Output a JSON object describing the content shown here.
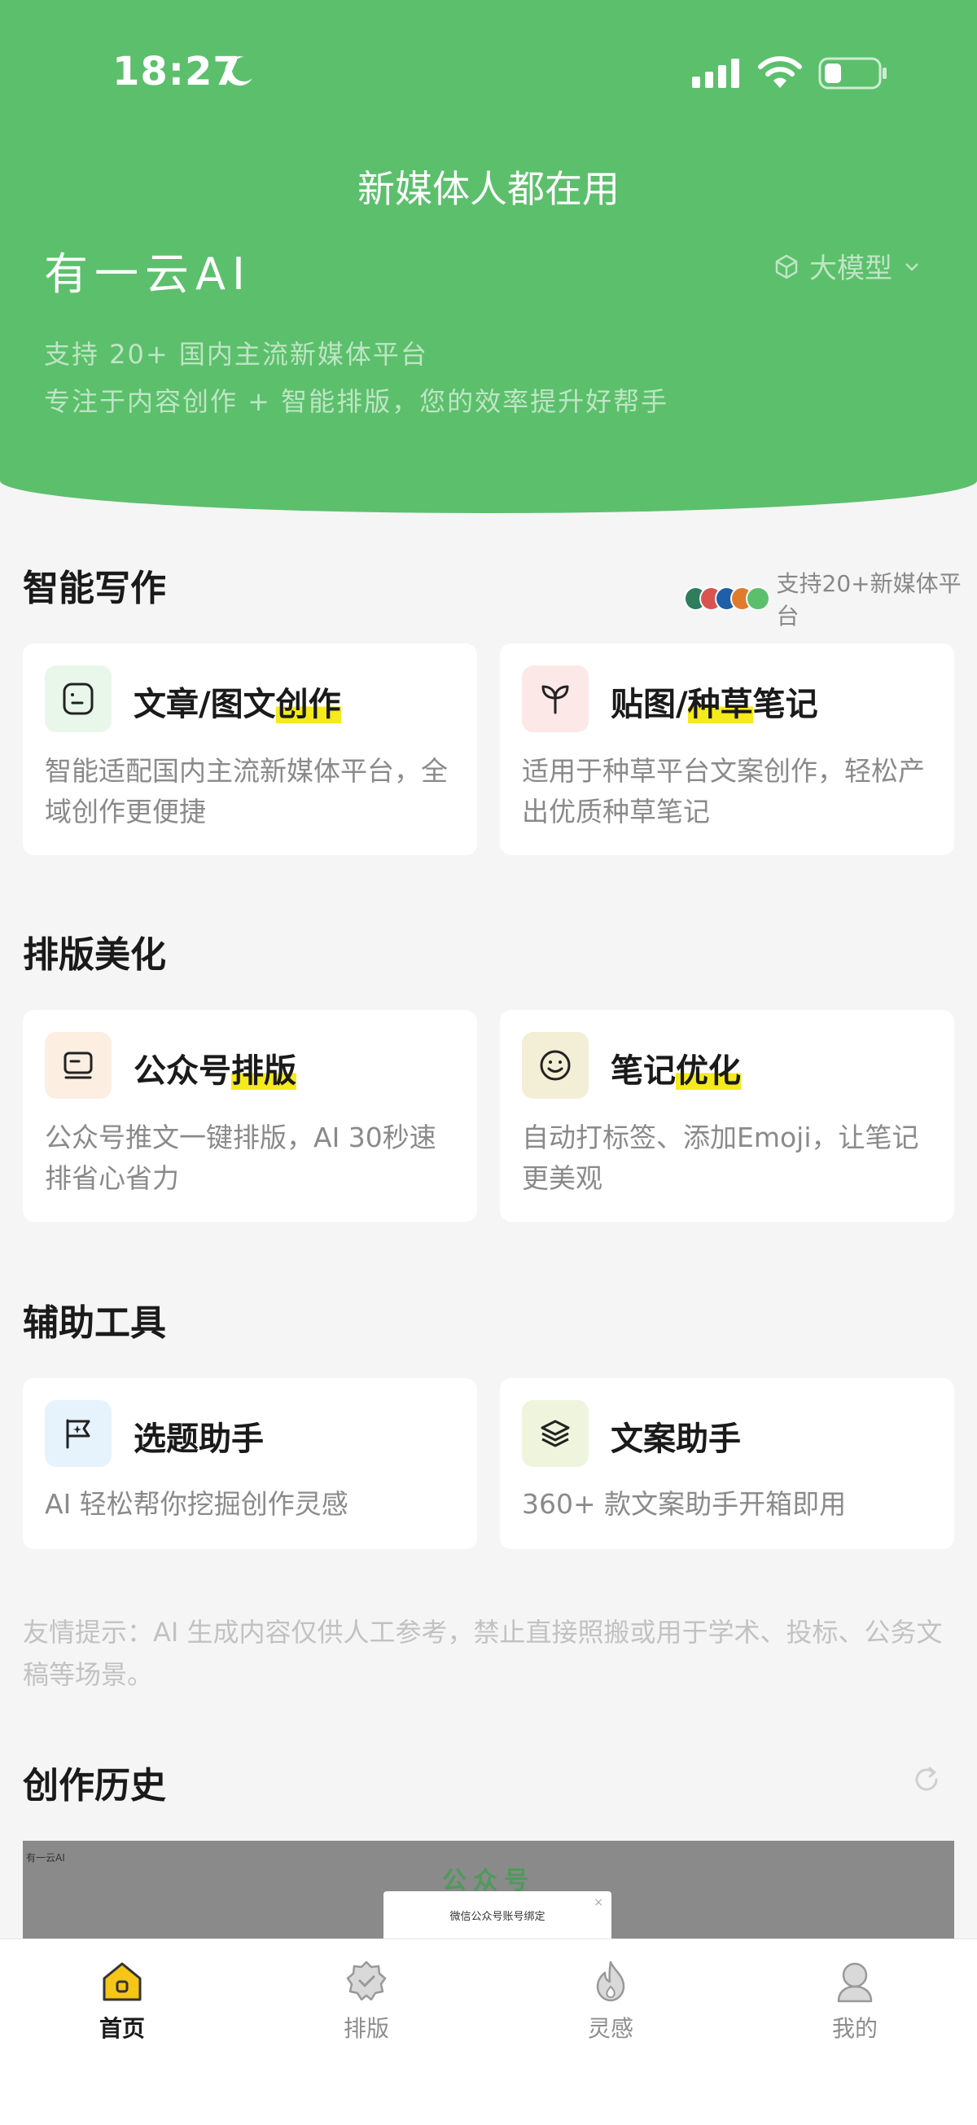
{
  "status_bar": {
    "time": "18:27"
  },
  "header": {
    "slogan": "新媒体人都在用",
    "brand": "有一云AI",
    "model_selector": "大模型",
    "desc_line1": "支持 20+ 国内主流新媒体平台",
    "desc_line2": "专注于内容创作 + 智能排版，您的效率提升好帮手"
  },
  "sections": {
    "writing": {
      "title": "智能写作",
      "platforms_label": "支持20+新媒体平台",
      "cards": [
        {
          "title_pre": "文章/图文",
          "title_hl": "创作",
          "title_post": "",
          "desc": "智能适配国内主流新媒体平台，全域创作更便捷",
          "icon": "doc-face-icon",
          "icon_bg": "#e8f7ea"
        },
        {
          "title_pre": "贴图/",
          "title_hl": "种草",
          "title_post": "笔记",
          "desc": "适用于种草平台文案创作，轻松产出优质种草笔记",
          "icon": "sprout-icon",
          "icon_bg": "#fde8e8"
        }
      ]
    },
    "layout": {
      "title": "排版美化",
      "cards": [
        {
          "title_pre": "公众号",
          "title_hl": "排版",
          "title_post": "",
          "desc": "公众号推文一键排版，AI 30秒速排省心省力",
          "icon": "monitor-icon",
          "icon_bg": "#fdeee2"
        },
        {
          "title_pre": "笔记",
          "title_hl": "优化",
          "title_post": "",
          "desc": "自动打标签、添加Emoji，让笔记更美观",
          "icon": "smiley-icon",
          "icon_bg": "#f3eed6"
        }
      ]
    },
    "tools": {
      "title": "辅助工具",
      "cards": [
        {
          "title": "选题助手",
          "desc": "AI 轻松帮你挖掘创作灵感",
          "icon": "flag-sparkle-icon",
          "icon_bg": "#e6f3fd"
        },
        {
          "title": "文案助手",
          "desc": "360+ 款文案助手开箱即用",
          "icon": "layers-icon",
          "icon_bg": "#eef5dc"
        }
      ]
    },
    "notice": "友情提示：AI 生成内容仅供人工参考，禁止直接照搬或用于学术、投标、公务文稿等场景。",
    "history": {
      "title": "创作历史",
      "preview_title": "公众号",
      "preview_corner": "有一云AI",
      "preview_dialog": "微信公众号账号绑定"
    }
  },
  "colors": {
    "brand_green": "#5cbf6c",
    "highlight_yellow": "#f5ea1c",
    "platform_dots": [
      "#2e7d5b",
      "#d9534f",
      "#1e5fa8",
      "#e07b2e",
      "#5cbf6c"
    ]
  },
  "tabbar": [
    {
      "label": "首页",
      "icon": "home-icon",
      "active": true
    },
    {
      "label": "排版",
      "icon": "badge-check-icon",
      "active": false
    },
    {
      "label": "灵感",
      "icon": "flame-icon",
      "active": false
    },
    {
      "label": "我的",
      "icon": "user-icon",
      "active": false
    }
  ]
}
